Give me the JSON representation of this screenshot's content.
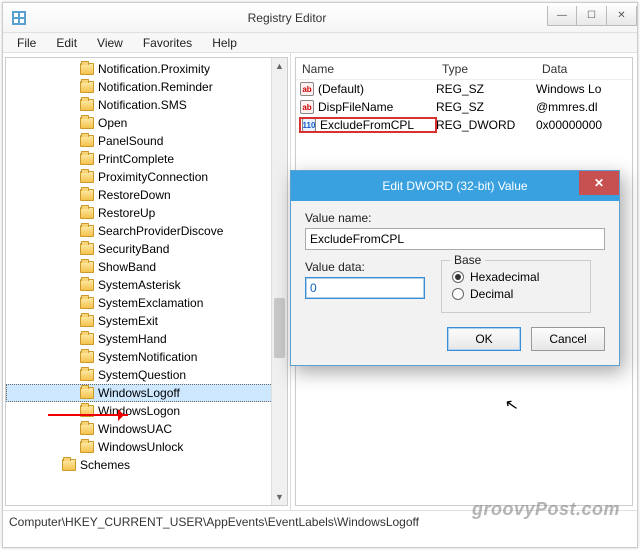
{
  "window": {
    "title": "Registry Editor"
  },
  "menu": {
    "file": "File",
    "edit": "Edit",
    "view": "View",
    "favorites": "Favorites",
    "help": "Help"
  },
  "tree": {
    "items": [
      "Notification.Proximity",
      "Notification.Reminder",
      "Notification.SMS",
      "Open",
      "PanelSound",
      "PrintComplete",
      "ProximityConnection",
      "RestoreDown",
      "RestoreUp",
      "SearchProviderDiscove",
      "SecurityBand",
      "ShowBand",
      "SystemAsterisk",
      "SystemExclamation",
      "SystemExit",
      "SystemHand",
      "SystemNotification",
      "SystemQuestion",
      "WindowsLogoff",
      "WindowsLogon",
      "WindowsUAC",
      "WindowsUnlock"
    ],
    "parent": "Schemes",
    "selected_index": 18
  },
  "detail": {
    "columns": {
      "name": "Name",
      "type": "Type",
      "data": "Data"
    },
    "rows": [
      {
        "icon": "str",
        "name": "(Default)",
        "type": "REG_SZ",
        "data": "Windows Lo"
      },
      {
        "icon": "str",
        "name": "DispFileName",
        "type": "REG_SZ",
        "data": "@mmres.dl"
      },
      {
        "icon": "bin",
        "name": "ExcludeFromCPL",
        "type": "REG_DWORD",
        "data": "0x00000000",
        "highlight": true
      }
    ]
  },
  "statusbar": {
    "path": "Computer\\HKEY_CURRENT_USER\\AppEvents\\EventLabels\\WindowsLogoff"
  },
  "dialog": {
    "title": "Edit DWORD (32-bit) Value",
    "value_name_label": "Value name:",
    "value_name": "ExcludeFromCPL",
    "value_data_label": "Value data:",
    "value_data": "0",
    "base_label": "Base",
    "hex_label": "Hexadecimal",
    "dec_label": "Decimal",
    "base_selected": "hex",
    "ok": "OK",
    "cancel": "Cancel"
  },
  "watermark": "groovyPost.com"
}
